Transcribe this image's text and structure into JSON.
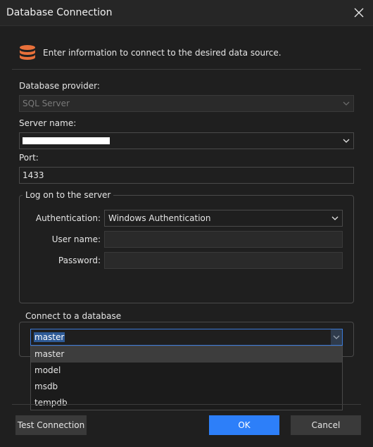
{
  "window": {
    "title": "Database Connection"
  },
  "header": {
    "icon": "database-icon",
    "text": "Enter information to connect to the desired data source.",
    "icon_color": "#e8703a"
  },
  "provider": {
    "label": "Database provider:",
    "value": "SQL Server"
  },
  "server": {
    "label": "Server name:",
    "value": ""
  },
  "port": {
    "label": "Port:",
    "value": "1433"
  },
  "logon": {
    "legend": "Log on to the server",
    "auth_label": "Authentication:",
    "auth_value": "Windows Authentication",
    "user_label": "User name:",
    "user_value": "",
    "password_label": "Password:",
    "password_value": ""
  },
  "database": {
    "legend": "Connect to a database",
    "value": "master",
    "options": [
      "master",
      "model",
      "msdb",
      "tempdb"
    ]
  },
  "buttons": {
    "test": "Test Connection",
    "ok": "OK",
    "cancel": "Cancel"
  },
  "colors": {
    "accent": "#2d7ff9",
    "background": "#1f1f1f"
  }
}
